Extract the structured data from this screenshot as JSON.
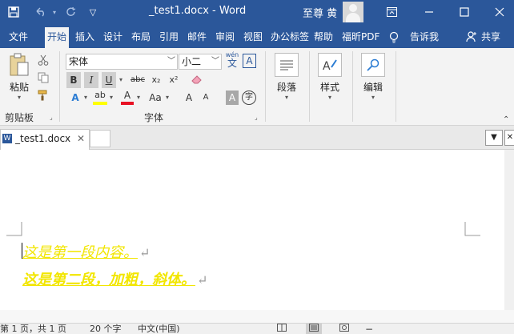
{
  "titlebar": {
    "title": "_test1.docx  -  Word",
    "user": "至尊 黄",
    "icons": [
      "save-icon",
      "undo-icon",
      "redo-icon",
      "customize-icon",
      "ribbon-display-icon",
      "minimize-icon",
      "maximize-icon",
      "close-icon"
    ]
  },
  "tabs": {
    "file": "文件",
    "home": "开始",
    "insert": "插入",
    "design": "设计",
    "layout": "布局",
    "references": "引用",
    "mailings": "邮件",
    "review": "审阅",
    "view": "视图",
    "office_tab": "办公标签",
    "help": "帮助",
    "foxit_pdf": "福昕PDF",
    "tell_me": "告诉我",
    "share": "共享"
  },
  "ribbon": {
    "clipboard": {
      "paste_label": "粘贴",
      "group_label": "剪贴板"
    },
    "font": {
      "font_name": "宋体",
      "font_size": "小二",
      "wen_label": "wén",
      "wen_char": "文",
      "bold": "B",
      "italic": "I",
      "underline": "U",
      "strikethrough": "abc",
      "subscript": "x₂",
      "superscript": "x²",
      "text_effects": "A",
      "highlight": "ab",
      "font_color": "A",
      "change_case": "Aa",
      "grow": "A",
      "shrink": "A",
      "char_shading": "A",
      "enclose": "字",
      "group_label": "字体"
    },
    "paragraph": {
      "label": "段落"
    },
    "styles": {
      "label": "样式"
    },
    "editing": {
      "label": "编辑"
    }
  },
  "doc_tab": {
    "name": "_test1.docx",
    "close": "✕"
  },
  "document": {
    "para1": "这是第一段内容。",
    "para2": "这是第二段，加粗，斜体。",
    "pmark": "↵"
  },
  "statusbar": {
    "page": "第 1 页，共 1 页",
    "words": "20 个字",
    "lang": "中文(中国)"
  },
  "colors": {
    "word_blue": "#2b579a",
    "ribbon_bg": "#f3f3f3",
    "text_yellow": "#f2e600",
    "highlight_yellow": "#ffff00",
    "font_red": "#e81123"
  }
}
